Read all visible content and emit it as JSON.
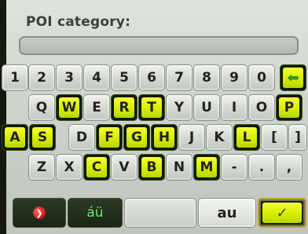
{
  "header": {
    "title": "POI category:"
  },
  "input": {
    "value": ""
  },
  "keyboard": {
    "row1": [
      "1",
      "2",
      "3",
      "4",
      "5",
      "6",
      "7",
      "8",
      "9",
      "0"
    ],
    "row2": [
      "Q",
      "W",
      "E",
      "R",
      "T",
      "Y",
      "U",
      "I",
      "O",
      "P"
    ],
    "row3": [
      "A",
      "S",
      "D",
      "F",
      "G",
      "H",
      "J",
      "K",
      "L",
      "[",
      "]"
    ],
    "row4": [
      "Z",
      "X",
      "C",
      "V",
      "B",
      "N",
      "M",
      "-",
      ".",
      ","
    ]
  },
  "bottom": {
    "accent_label": "áü",
    "space_label": "",
    "abc_label": "au"
  },
  "icons": {
    "backspace": "arrow-left",
    "cancel": "stop-octagon",
    "confirm": "checkmark"
  },
  "colors": {
    "highlight_key": "#e6f200",
    "ok_border": "#c79d25",
    "dark_key": "#1a2515"
  }
}
